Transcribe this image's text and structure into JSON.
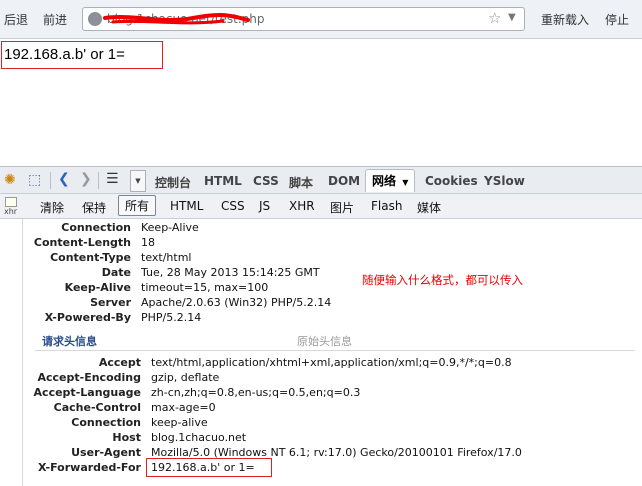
{
  "browser": {
    "back_label": "后退",
    "forward_label": "前进",
    "url": "blog.1chacuo.net/test.php",
    "reload_label": "重新载入",
    "stop_label": "停止"
  },
  "page": {
    "content": "192.168.a.b' or 1="
  },
  "firebug": {
    "tabs": [
      "控制台",
      "HTML",
      "CSS",
      "脚本",
      "DOM",
      "网络",
      "Cookies",
      "YSlow"
    ],
    "active_tab": "网络",
    "net_toolbar": {
      "clear": "清除",
      "persist": "保持",
      "filters": [
        "所有",
        "HTML",
        "CSS",
        "JS",
        "XHR",
        "图片",
        "Flash",
        "媒体"
      ],
      "xhr_label": "xhr"
    }
  },
  "response_headers": [
    {
      "name": "Connection",
      "value": "Keep-Alive"
    },
    {
      "name": "Content-Length",
      "value": "18"
    },
    {
      "name": "Content-Type",
      "value": "text/html"
    },
    {
      "name": "Date",
      "value": "Tue, 28 May 2013 15:14:25 GMT"
    },
    {
      "name": "Keep-Alive",
      "value": "timeout=15, max=100"
    },
    {
      "name": "Server",
      "value": "Apache/2.0.63 (Win32) PHP/5.2.14"
    },
    {
      "name": "X-Powered-By",
      "value": "PHP/5.2.14"
    }
  ],
  "annotation": "随便输入什么格式，都可以传入",
  "request_section": {
    "title": "请求头信息",
    "raw_link": "原始头信息"
  },
  "request_headers": [
    {
      "name": "Accept",
      "value": "text/html,application/xhtml+xml,application/xml;q=0.9,*/*;q=0.8"
    },
    {
      "name": "Accept-Encoding",
      "value": "gzip, deflate"
    },
    {
      "name": "Accept-Language",
      "value": "zh-cn,zh;q=0.8,en-us;q=0.5,en;q=0.3"
    },
    {
      "name": "Cache-Control",
      "value": "max-age=0"
    },
    {
      "name": "Connection",
      "value": "keep-alive"
    },
    {
      "name": "Host",
      "value": "blog.1chacuo.net"
    },
    {
      "name": "User-Agent",
      "value": "Mozilla/5.0 (Windows NT 6.1; rv:17.0) Gecko/20100101 Firefox/17.0"
    },
    {
      "name": "X-Forwarded-For",
      "value": "192.168.a.b' or 1="
    }
  ]
}
